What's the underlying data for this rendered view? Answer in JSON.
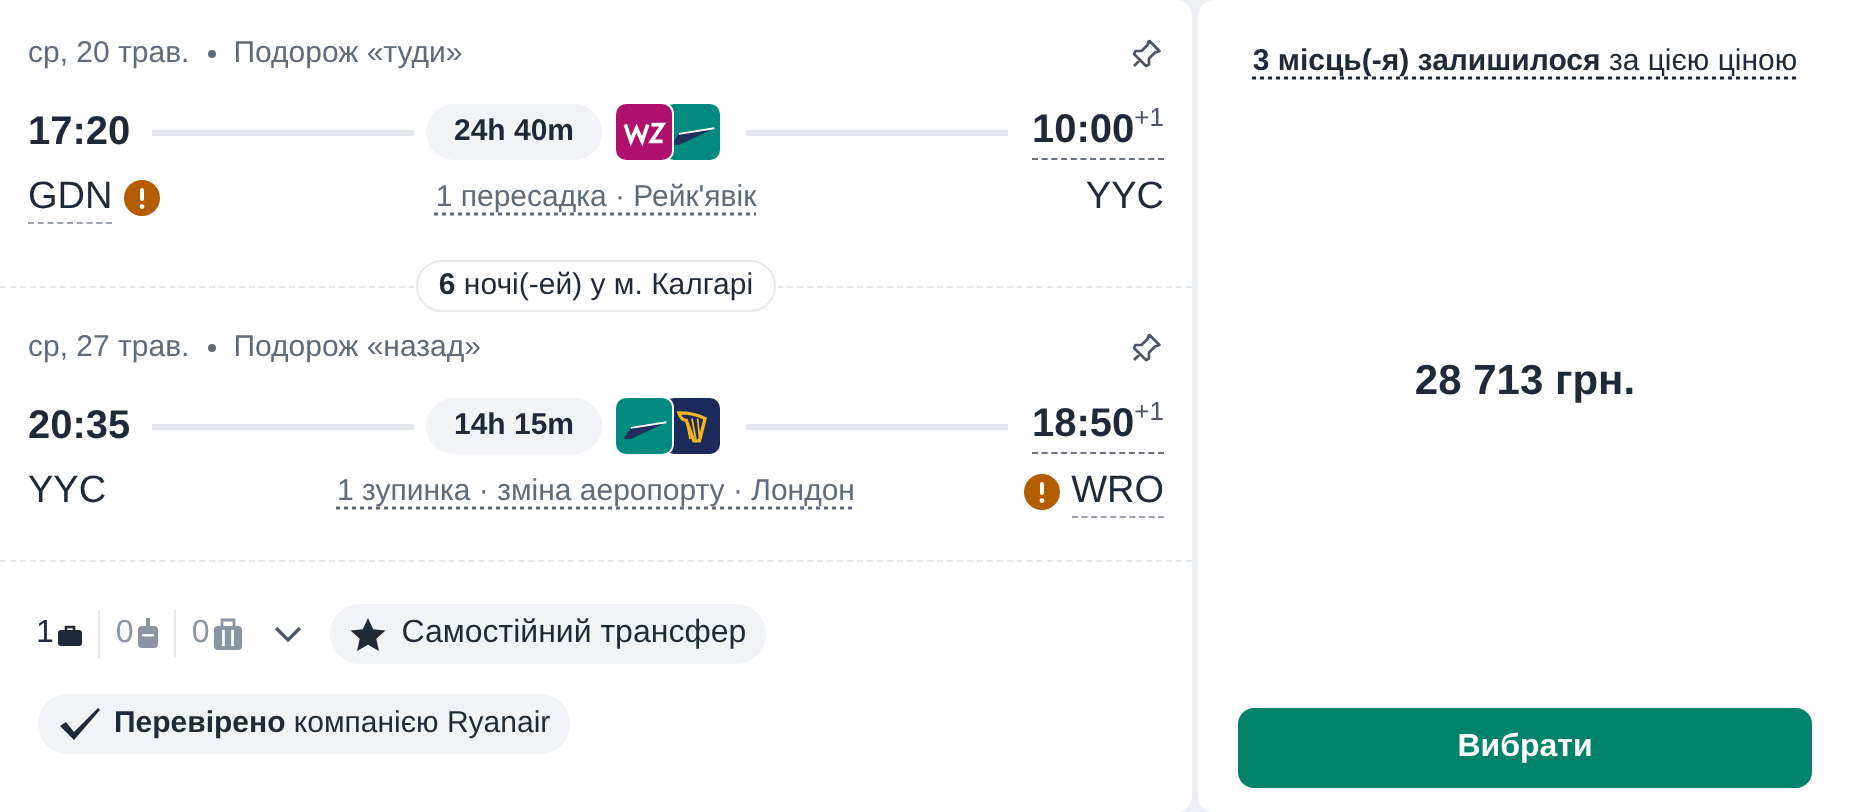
{
  "segments": [
    {
      "date": "ср, 20 трав.",
      "direction": "Подорож «туди»",
      "depart_time": "17:20",
      "duration": "24h 40m",
      "airlines": [
        {
          "kind": "wizz"
        },
        {
          "kind": "teal"
        }
      ],
      "arrive_time": "10:00",
      "day_offset": "+1",
      "from": {
        "code": "GDN",
        "warning": true
      },
      "stops": "1 пересадка · Рейк'явік",
      "to": {
        "code": "YYC",
        "warning": false
      }
    },
    {
      "date": "ср, 27 трав.",
      "direction": "Подорож «назад»",
      "depart_time": "20:35",
      "duration": "14h 15m",
      "airlines": [
        {
          "kind": "teal"
        },
        {
          "kind": "ryanair"
        }
      ],
      "arrive_time": "18:50",
      "day_offset": "+1",
      "from": {
        "code": "YYC",
        "warning": false
      },
      "stops": "1 зупинка · зміна аеропорту · Лондон",
      "to": {
        "code": "WRO",
        "warning": true
      }
    }
  ],
  "stay": "**6** ночі(-ей) у м. Калгарі",
  "baggage": [
    {
      "kind": "personal",
      "count": "1"
    },
    {
      "kind": "cabin",
      "count": "0"
    },
    {
      "kind": "checked",
      "count": "0"
    }
  ],
  "transfer_badge": "Самостійний трансфер",
  "verified_badge": "**Перевірено** компанією Ryanair",
  "seats_note": "**3 місць(-я) залишилося** за цією ціною",
  "price": "28 713 грн.",
  "select_button": "Вибрати"
}
